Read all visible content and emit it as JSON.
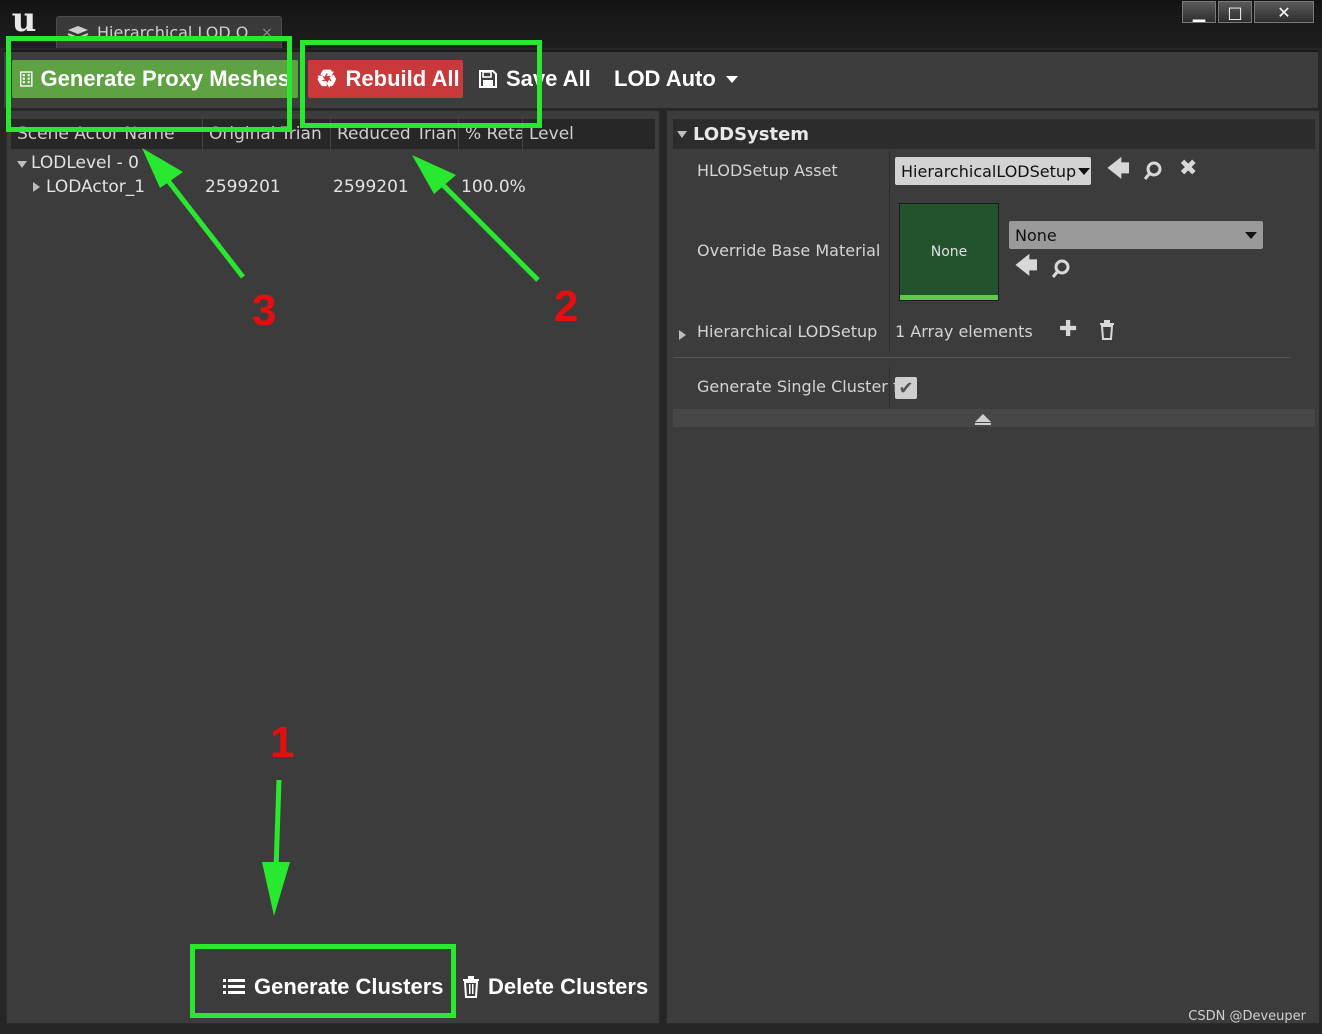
{
  "window": {
    "tab_title": "Hierarchical LOD O",
    "tab_close": "×",
    "minimize": "▁",
    "maximize": "□",
    "close": "✕"
  },
  "toolbar": {
    "generate_proxy": "Generate Proxy Meshes",
    "rebuild_all": "Rebuild All",
    "save_all": "Save All",
    "lod_auto": "LOD Auto"
  },
  "tree": {
    "columns": [
      "Scene Actor Name",
      "Original Trian",
      "Reduced Trian",
      "% Reta",
      "Level"
    ],
    "level_row": "LODLevel - 0",
    "actor_row": {
      "name": "LODActor_1",
      "original": "2599201",
      "reduced": "2599201",
      "retained": "100.0%"
    }
  },
  "bottom": {
    "generate_clusters": "Generate Clusters",
    "delete_clusters": "Delete Clusters"
  },
  "details": {
    "category": "LODSystem",
    "hlod_setup_asset_label": "HLODSetup Asset",
    "hlod_setup_asset_value": "HierarchicalLODSetup",
    "override_material_label": "Override Base Material",
    "material_thumb": "None",
    "material_value": "None",
    "hierarchical_lodsetup_label": "Hierarchical LODSetup",
    "array_elements": "1 Array elements",
    "single_cluster_label": "Generate Single Cluster f"
  },
  "annotations": [
    "1",
    "2",
    "3"
  ],
  "watermark": "CSDN @Deveuper",
  "colors": {
    "highlight": "#29e830",
    "annotation_number": "#e60e0e",
    "proxy_button": "#5fa244",
    "rebuild_button": "#c9383a"
  }
}
